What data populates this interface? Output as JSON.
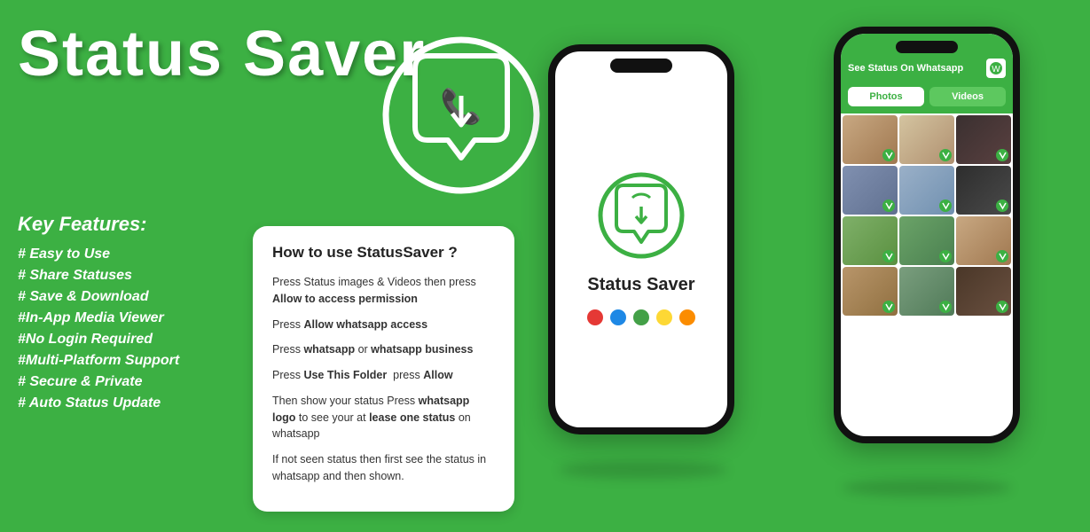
{
  "title": "Status Saver",
  "keyFeatures": {
    "heading": "Key Features:",
    "items": [
      "# Easy to Use",
      "# Share Statuses",
      "# Save & Download",
      "#In-App Media Viewer",
      "#No Login Required",
      "#Multi-Platform Support",
      "# Secure & Private",
      "# Auto Status Update"
    ]
  },
  "howToCard": {
    "title": "How to use StatusSaver ?",
    "steps": [
      {
        "text": "Press Status images & Videos then press ",
        "bold": "Allow to access permission"
      },
      {
        "text": "Press ",
        "bold": "Allow whatsapp access"
      },
      {
        "text": "Press ",
        "bold": "whatsapp",
        "text2": " or ",
        "bold2": "whatsapp business"
      },
      {
        "text": "Press ",
        "bold": "Use This Folder",
        "text2": "  press ",
        "bold2": "Allow"
      },
      {
        "text": "Then show your status Press ",
        "bold": "whatsapp logo",
        "text2": " to see your at ",
        "bold2": "lease one status",
        "text3": " on whatsapp"
      },
      {
        "text": "If not seen status then first see the status in whatsapp and then shown.",
        "bold": ""
      }
    ]
  },
  "phone1": {
    "appTitle": "Status Saver",
    "dots": [
      {
        "color": "#e53935"
      },
      {
        "color": "#1e88e5"
      },
      {
        "color": "#43a047"
      },
      {
        "color": "#fdd835"
      },
      {
        "color": "#fb8c00"
      }
    ]
  },
  "phone2": {
    "headerTitle": "See Status On Whatsapp",
    "tabs": [
      "Photos",
      "Videos"
    ]
  },
  "photoColors": [
    "#c8a882",
    "#d4b896",
    "#4a3728",
    "#8b9dc3",
    "#a0b4c8",
    "#2d2d2d",
    "#7fb069",
    "#6ba368",
    "#c8a882",
    "#b8956a",
    "#7a9e7e",
    "#4a3728"
  ]
}
